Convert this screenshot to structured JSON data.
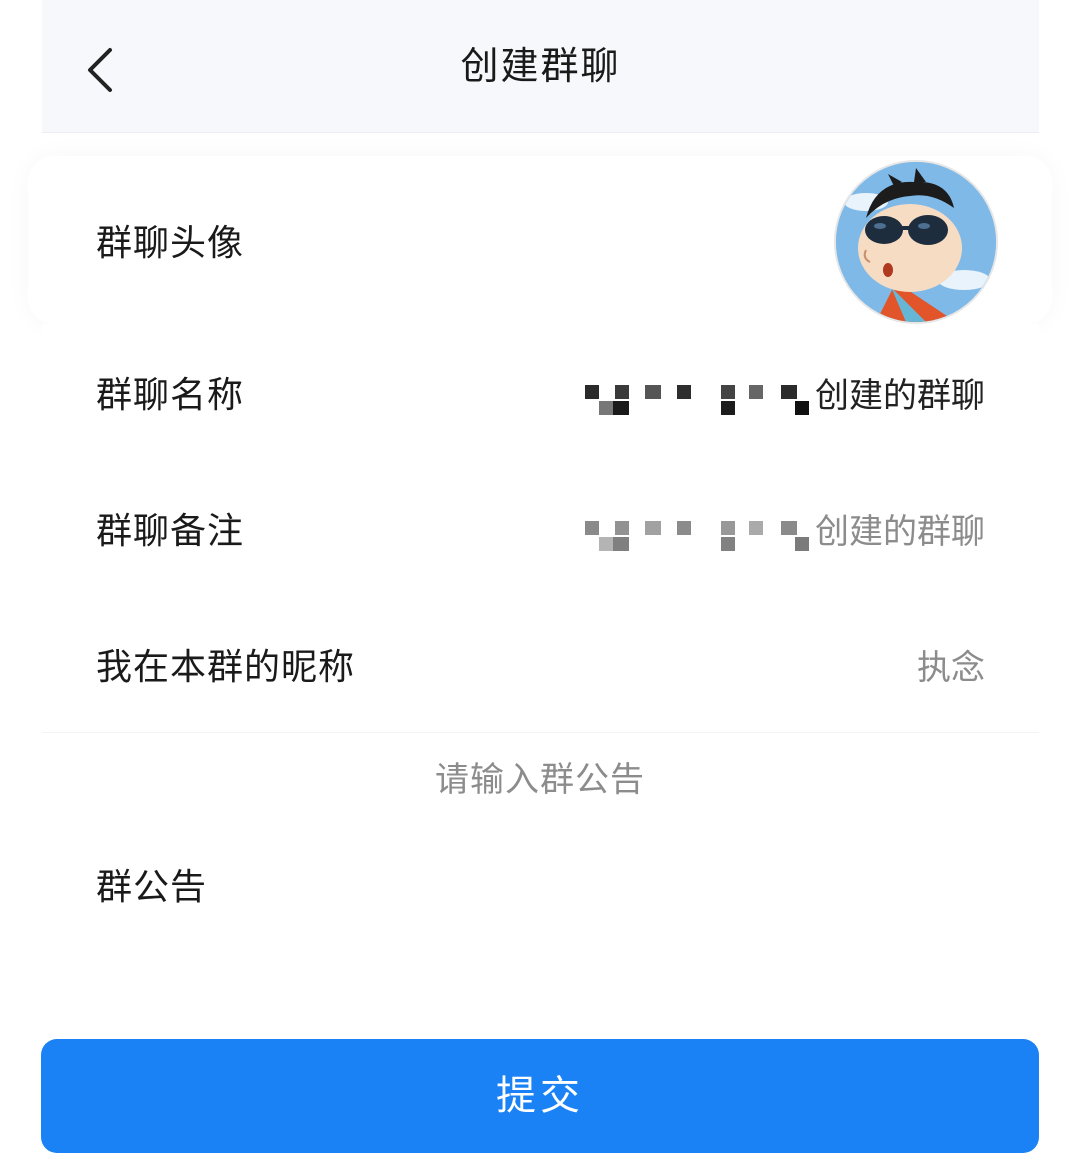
{
  "header": {
    "title": "创建群聊",
    "back_icon": "chevron-left-icon"
  },
  "rows": {
    "avatar": {
      "label": "群聊头像"
    },
    "name": {
      "label": "群聊名称",
      "value_suffix": "创建的群聊"
    },
    "remark": {
      "label": "群聊备注",
      "value_suffix": "创建的群聊"
    },
    "nickname": {
      "label": "我在本群的昵称",
      "value": "执念"
    }
  },
  "announcement": {
    "placeholder": "请输入群公告",
    "label": "群公告"
  },
  "submit": {
    "label": "提交"
  },
  "colors": {
    "accent": "#1a82f5",
    "header_bg": "#f7f8fc",
    "secondary_text": "#8c8c8c",
    "primary_text": "#1a1a1a"
  }
}
